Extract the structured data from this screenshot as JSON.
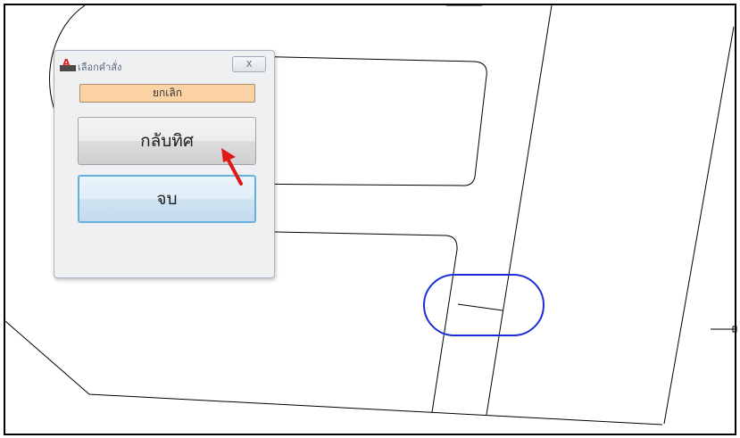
{
  "dialog": {
    "title": "เลือกคำสั่ง",
    "close_label": "X",
    "cancel_label": "ยกเลิก",
    "reverse_label": "กลับทิศ",
    "finish_label": "จบ"
  },
  "colors": {
    "cad_line": "#000000",
    "selection_highlight": "#1c2fd6",
    "cancel_button_bg": "#fbd2a4",
    "pointer_arrow": "#e01818"
  }
}
